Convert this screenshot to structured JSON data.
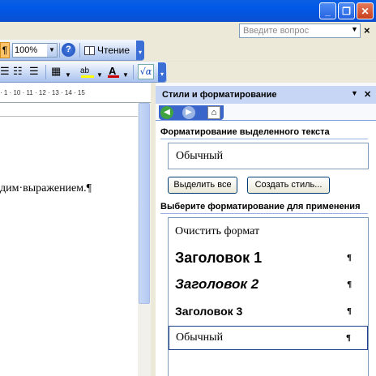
{
  "window": {
    "minimize_glyph": "_",
    "restore_glyph": "❐",
    "close_glyph": "✕"
  },
  "menubar": {
    "search_placeholder": "Введите вопрос",
    "close_doc_glyph": "×"
  },
  "toolbar1": {
    "show_marks_glyph": "¶",
    "zoom_value": "100%",
    "help_glyph": "?",
    "read_label": "Чтение"
  },
  "toolbar2": {
    "formula_label": "√α"
  },
  "ruler": {
    "ticks": "· 1 · 10 · 11 · 12 · 13 · 14 · 15"
  },
  "document": {
    "line1": "дим·выражением.¶"
  },
  "pane": {
    "title": "Стили и форматирование",
    "section_selected": "Форматирование выделенного текста",
    "current_style": "Обычный",
    "select_all_label": "Выделить все",
    "new_style_label": "Создать стиль...",
    "section_apply": "Выберите форматирование для применения",
    "styles": [
      {
        "label": "Очистить формат",
        "mark": ""
      },
      {
        "label": "Заголовок 1",
        "mark": "¶"
      },
      {
        "label": "Заголовок 2",
        "mark": "¶"
      },
      {
        "label": "Заголовок 3",
        "mark": "¶"
      },
      {
        "label": "Обычный",
        "mark": "¶"
      }
    ]
  },
  "colors": {
    "title_blue": "#0a5fe2",
    "pane_header": "#c7d6f5",
    "font_color": "#cc0000",
    "highlight": "#ffff00"
  }
}
